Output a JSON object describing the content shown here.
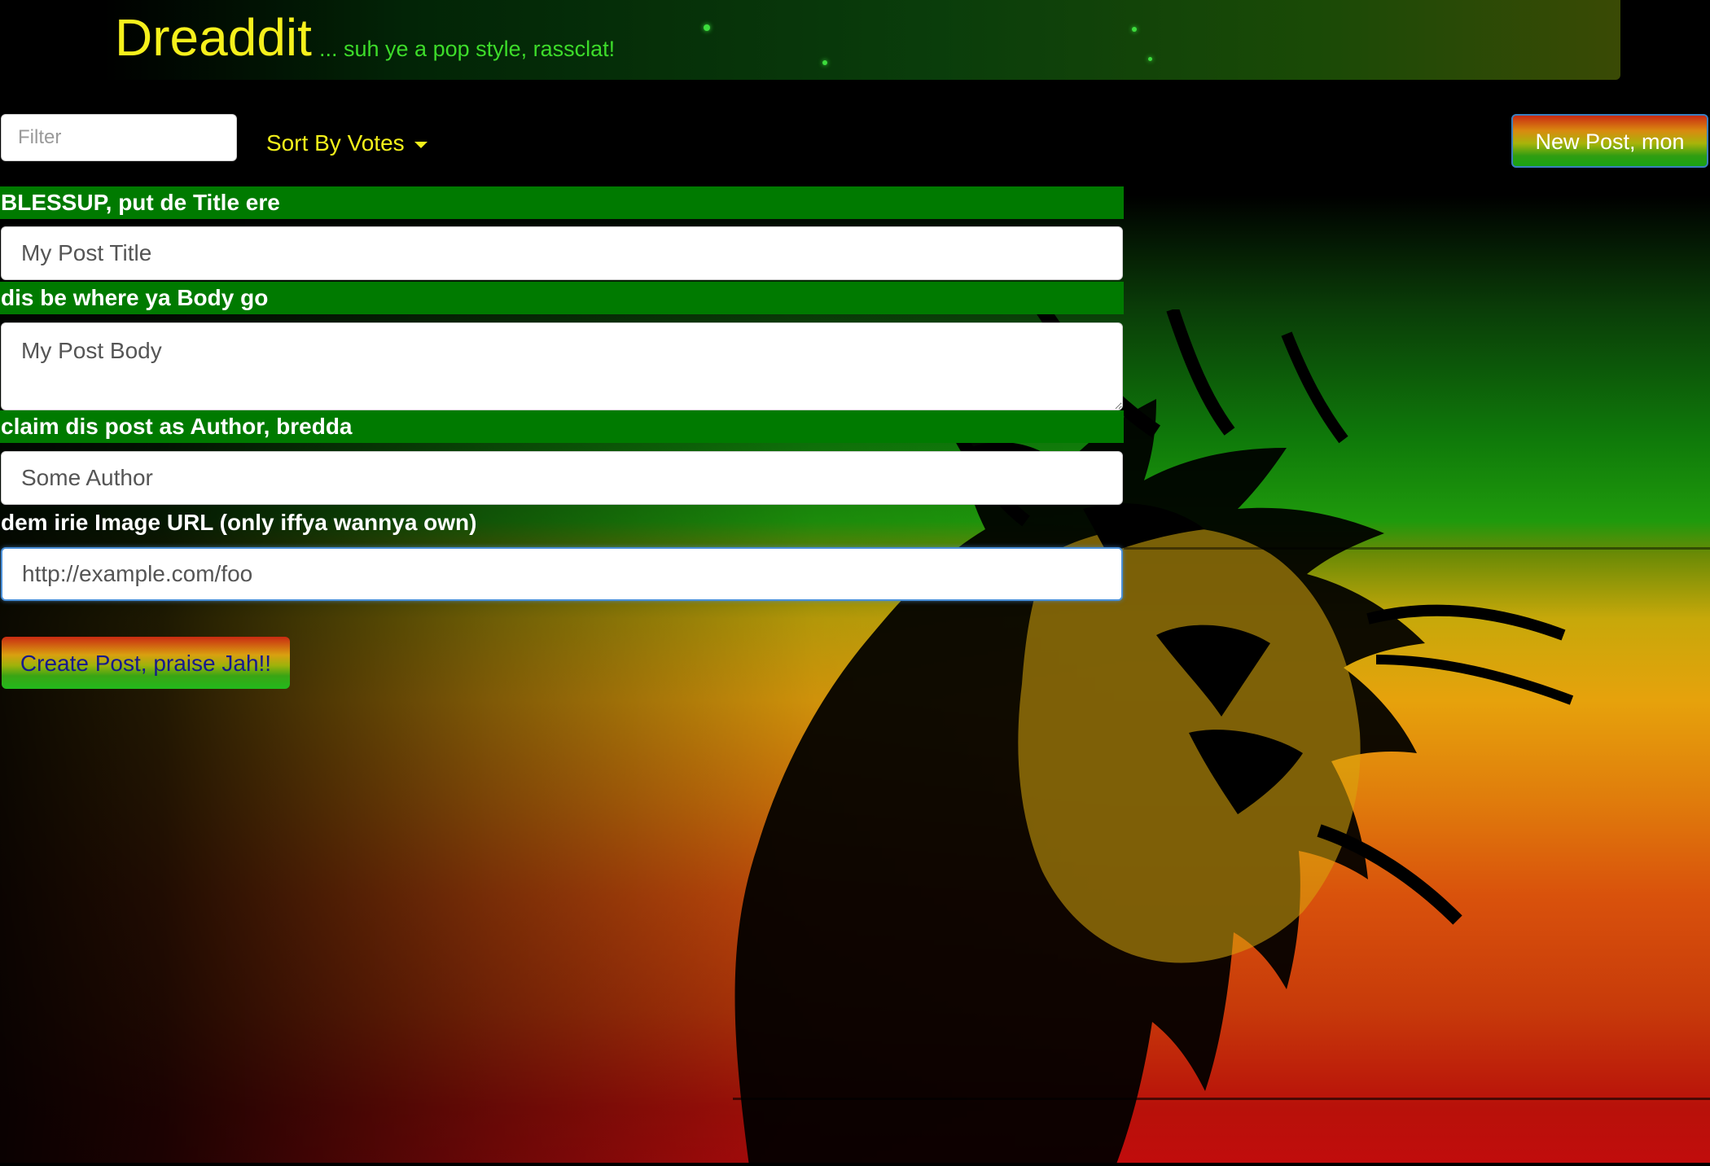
{
  "header": {
    "brand": "Dreaddit",
    "tagline": "... suh ye a pop style, rassclat!"
  },
  "toolbar": {
    "filter_placeholder": "Filter",
    "sort_label": "Sort By Votes",
    "new_post_label": "New Post, mon"
  },
  "form": {
    "title_label": "BLESSUP, put de Title ere",
    "title_value": "My Post Title",
    "body_label": "dis be where ya Body go",
    "body_value": "My Post Body",
    "author_label": "claim dis post as Author, bredda",
    "author_value": "Some Author",
    "image_label": "dem irie Image URL (only iffya wannya own)",
    "image_value": "http://example.com/foo",
    "submit_label": "Create Post, praise Jah!!"
  },
  "colors": {
    "brand": "#f6f01c",
    "tagline": "#3ddc2a",
    "label_bar": "#007a00",
    "sort": "#f4f11a",
    "submit_text": "#161a8c"
  },
  "icons": {
    "sort_caret": "chevron-down-icon",
    "background": "lion-illustration"
  }
}
